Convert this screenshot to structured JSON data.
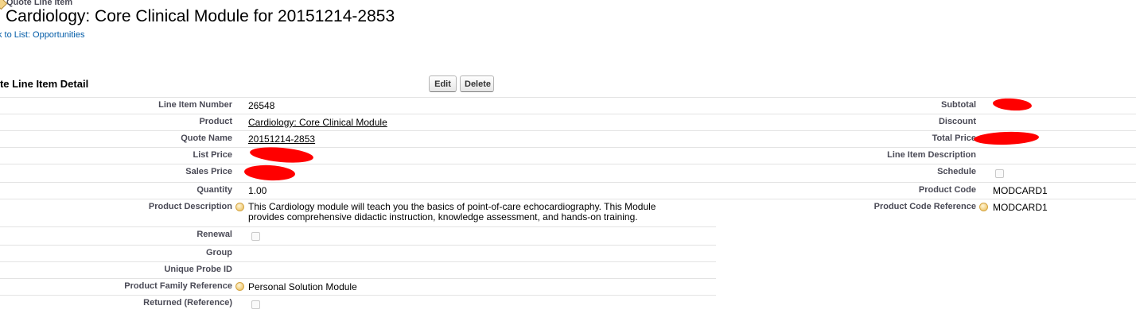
{
  "header": {
    "object_label": "Quote Line Item",
    "title": "Cardiology: Core Clinical Module for 20151214-2853",
    "back_link": "k to List: Opportunities"
  },
  "section": {
    "title": "ote Line Item Detail",
    "buttons": {
      "edit": "Edit",
      "delete": "Delete"
    }
  },
  "fields_left": {
    "line_item_number": {
      "label": "Line Item Number",
      "value": "26548"
    },
    "product": {
      "label": "Product",
      "value": "Cardiology: Core Clinical Module"
    },
    "quote_name": {
      "label": "Quote Name",
      "value": "20151214-2853"
    },
    "list_price": {
      "label": "List Price",
      "value": ""
    },
    "sales_price": {
      "label": "Sales Price",
      "value": ""
    },
    "quantity": {
      "label": "Quantity",
      "value": "1.00"
    },
    "product_description": {
      "label": "Product Description",
      "value": "This Cardiology module will teach you the basics of point-of-care echocardiography. This Module provides comprehensive didactic instruction, knowledge assessment, and hands-on training."
    },
    "renewal": {
      "label": "Renewal",
      "checked": false
    },
    "group": {
      "label": "Group",
      "value": ""
    },
    "unique_probe_id": {
      "label": "Unique Probe ID",
      "value": ""
    },
    "product_family_reference": {
      "label": "Product Family Reference",
      "value": "Personal Solution Module"
    },
    "returned_reference": {
      "label": "Returned (Reference)",
      "checked": false
    }
  },
  "fields_right": {
    "subtotal": {
      "label": "Subtotal",
      "value": ""
    },
    "discount": {
      "label": "Discount",
      "value": ""
    },
    "total_price": {
      "label": "Total Price",
      "value": ""
    },
    "line_item_description": {
      "label": "Line Item Description",
      "value": ""
    },
    "schedule": {
      "label": "Schedule",
      "checked": false
    },
    "product_code": {
      "label": "Product Code",
      "value": "MODCARD1"
    },
    "product_code_reference": {
      "label": "Product Code Reference",
      "value": "MODCARD1"
    }
  },
  "colors": {
    "link": "#015ba7",
    "label": "#4a4a56",
    "divider": "#e3e3e3",
    "redaction": "#ff0000"
  }
}
